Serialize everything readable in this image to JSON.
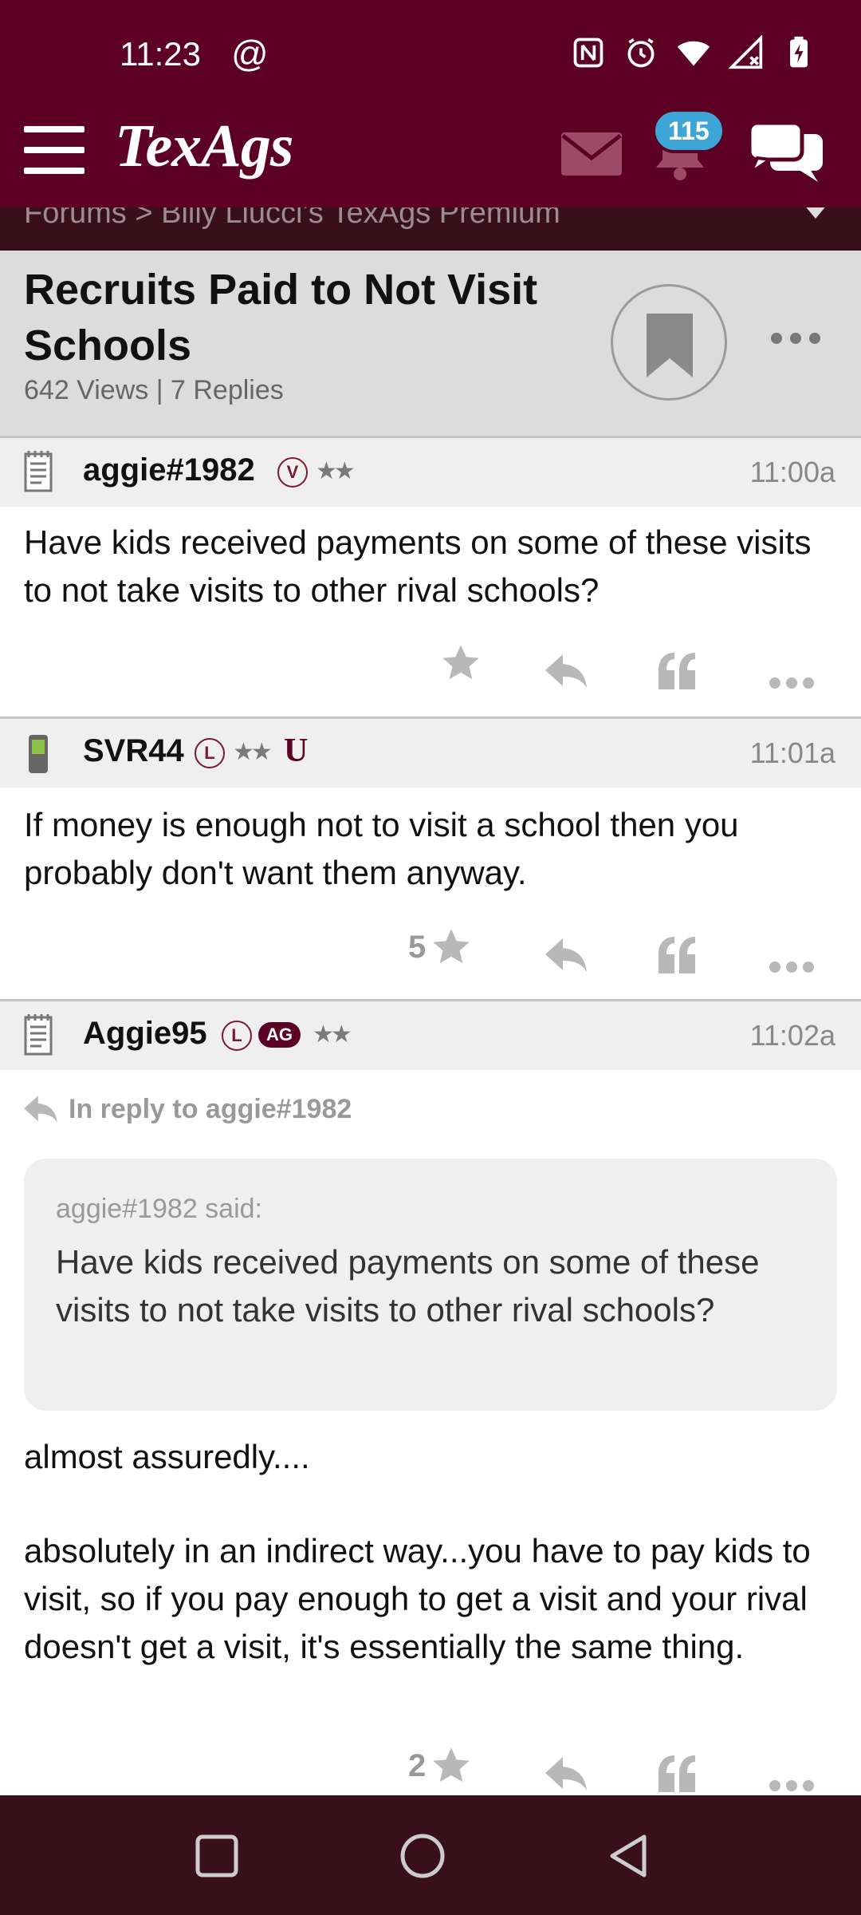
{
  "status_bar": {
    "time": "11:23",
    "at_symbol": "@",
    "icons": [
      "nfc-icon",
      "alarm-icon",
      "wifi-icon",
      "signal-icon",
      "battery-charging-icon"
    ]
  },
  "header": {
    "logo": "TexAgs",
    "notification_count": "115",
    "icons": [
      "menu-icon",
      "mail-icon",
      "bell-icon",
      "chat-icon"
    ],
    "breadcrumb": "Forums > Billy Liucci's TexAgs Premium"
  },
  "topic": {
    "title": "Recruits Paid to Not Visit Schools",
    "views": "642 Views",
    "separator": "|",
    "replies": "7 Replies"
  },
  "posts": [
    {
      "username": "aggie#1982",
      "badge_letter": "V",
      "stars": "★★",
      "time": "11:00a",
      "body": "Have kids received payments on some of these visits to not take visits to other rival schools?",
      "star_count": ""
    },
    {
      "username": "SVR44",
      "badge_letter": "L",
      "stars": "★★",
      "u_badge": "U",
      "time": "11:01a",
      "body": "If money is enough not to visit a school then you probably don't want them anyway.",
      "star_count": "5"
    },
    {
      "username": "Aggie95",
      "badge_letter": "L",
      "ag_badge": "AG",
      "stars": "★★",
      "time": "11:02a",
      "in_reply_to": "In reply to aggie#1982",
      "quote_author": "aggie#1982 said:",
      "quote_text": "Have kids received payments on some of these visits to not take visits to other rival schools?",
      "body_line1": "almost assuredly....",
      "body_line2": "absolutely in an indirect way...you have to pay kids to visit, so if you pay enough to get a visit and your rival doesn't get a visit, it's essentially the same thing.",
      "star_count": "2"
    }
  ],
  "colors": {
    "maroon": "#5c0024",
    "dark_maroon": "#3a0f1c",
    "badge_blue": "#3ea6d6"
  }
}
